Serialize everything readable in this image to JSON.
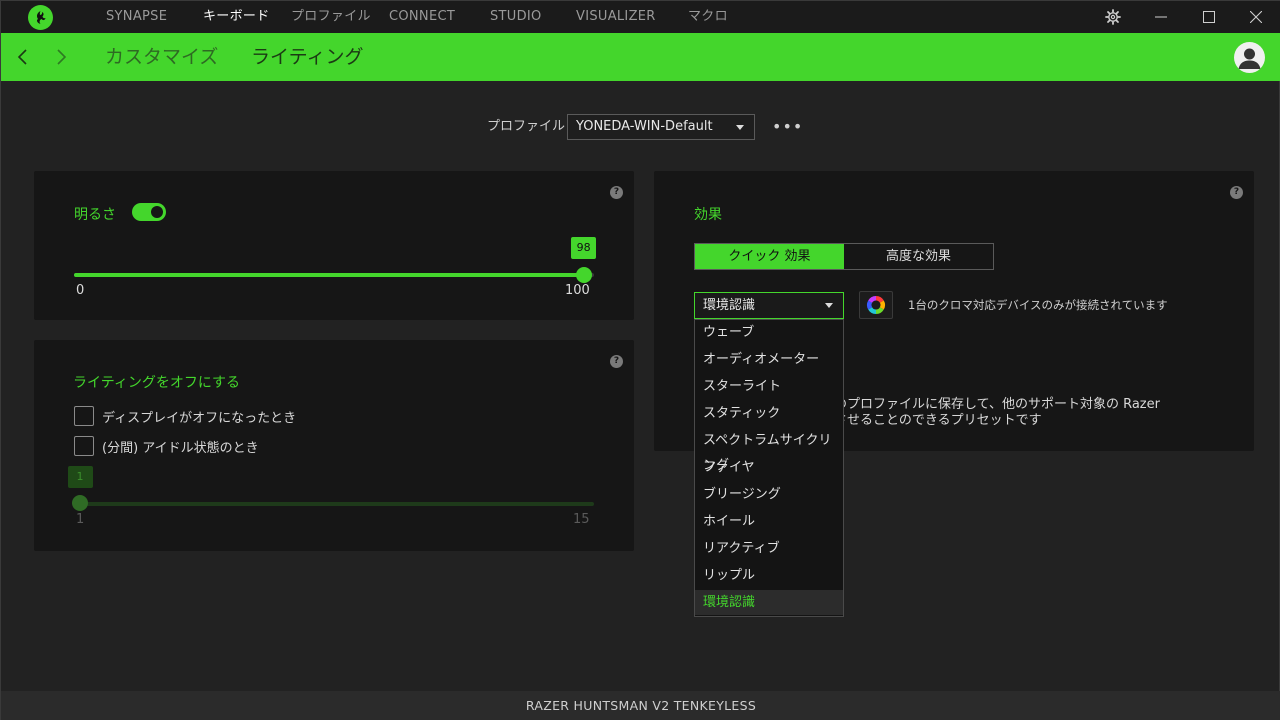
{
  "topnav": {
    "items": [
      {
        "label": "SYNAPSE"
      },
      {
        "label": "キーボード"
      },
      {
        "label": "プロファイル"
      },
      {
        "label": "CONNECT"
      },
      {
        "label": "STUDIO"
      },
      {
        "label": "VISUALIZER"
      },
      {
        "label": "マクロ"
      }
    ],
    "active_index": 1
  },
  "window_controls": {
    "icons": [
      "gear-icon",
      "minimize-icon",
      "maximize-icon",
      "close-icon"
    ]
  },
  "subnav": {
    "items": [
      {
        "label": "カスタマイズ"
      },
      {
        "label": "ライティング"
      }
    ],
    "active_index": 1
  },
  "profile": {
    "label": "プロファイル",
    "selected": "YONEDA-WIN-Default",
    "more": "•••"
  },
  "brightness": {
    "label": "明るさ",
    "enabled": true,
    "value": "98",
    "min_label": "0",
    "max_label": "100",
    "min": 0,
    "max": 100,
    "level": 98
  },
  "lighting_off": {
    "title": "ライティングをオフにする",
    "options": [
      {
        "label": "ディスプレイがオフになったとき",
        "checked": false
      },
      {
        "label": "(分間) アイドル状態のとき",
        "checked": false
      }
    ],
    "idle_value": "1",
    "min_label": "1",
    "max_label": "15",
    "min": 1,
    "max": 15,
    "level": 1
  },
  "effects": {
    "title": "効果",
    "tabs": [
      {
        "label": "クイック 効果"
      },
      {
        "label": "高度な効果"
      }
    ],
    "active_tab": 0,
    "selected_effect": "環境認識",
    "chroma_note": "1台のクロマ対応デバイスのみが接続されています",
    "description_line1": "スのプロファイルに保存して、他のサポート対象の Razer",
    "description_line2": "期させることのできるプリセットです",
    "options": [
      {
        "label": "ウェーブ"
      },
      {
        "label": "オーディオメーター"
      },
      {
        "label": "スターライト"
      },
      {
        "label": "スタティック"
      },
      {
        "label": "スペクトラムサイクリング"
      },
      {
        "label": "ファイヤ"
      },
      {
        "label": "ブリージング"
      },
      {
        "label": "ホイール"
      },
      {
        "label": "リアクティブ"
      },
      {
        "label": "リップル"
      },
      {
        "label": "環境認識"
      }
    ]
  },
  "help_text": "?",
  "status": {
    "device": "RAZER HUNTSMAN V2 TENKEYLESS"
  },
  "colors": {
    "accent": "#44d62c",
    "panel": "#161616",
    "background": "#222222"
  }
}
